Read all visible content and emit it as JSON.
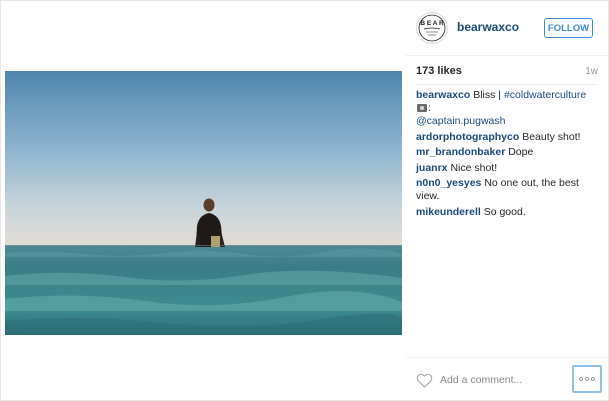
{
  "post": {
    "username": "bearwaxco",
    "follow_label": "FOLLOW",
    "likes": "173 likes",
    "age": "1w",
    "caption": {
      "user": "bearwaxco",
      "text": " Bliss | ",
      "hashtag": "#coldwaterculture",
      "after_emoji": ":",
      "mention": "@captain.pugwash"
    },
    "comments": [
      {
        "user": "ardorphotographyco",
        "text": "Beauty shot!"
      },
      {
        "user": "mr_brandonbaker",
        "text": "Dope"
      },
      {
        "user": "juanrx",
        "text": "Nice shot!"
      },
      {
        "user": "n0n0_yesyes",
        "text": "No one out, the best view."
      },
      {
        "user": "mikeunderell",
        "text": "So good."
      }
    ],
    "comment_input_placeholder": "Add a comment...",
    "icons": {
      "avatar": "bear-wax-logo",
      "like": "heart-outline-icon",
      "more": "ellipsis-icon",
      "emoji": "camera-emoji"
    },
    "colors": {
      "link": "#1a4b78",
      "follow": "#3f8ad6",
      "more_focus": "#8fc2e8"
    }
  }
}
